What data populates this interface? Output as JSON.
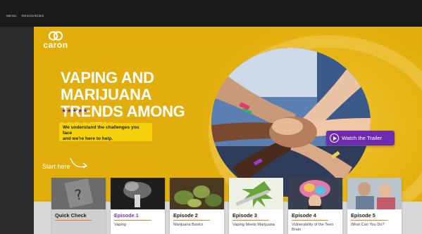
{
  "topbar": {
    "nav": [
      "MENU",
      "RESOURCES"
    ]
  },
  "logo": {
    "word": "caron"
  },
  "hero": {
    "headline_line1": "VAPING AND MARIJUANA",
    "headline_line2": "TRENDS AMONG YOUTH",
    "stars": "★★★★★",
    "callout_line1": "We understand the challenges you face",
    "callout_line2": "and we're here to help.",
    "start_label": "Start here",
    "trailer_label": "Watch the Trailer"
  },
  "cards": [
    {
      "title": "Quick Check",
      "subtitle": ""
    },
    {
      "title": "Episode 1",
      "subtitle": "Vaping"
    },
    {
      "title": "Episode 2",
      "subtitle": "Marijuana Basics"
    },
    {
      "title": "Episode 3",
      "subtitle": "Vaping Meets Marijuana"
    },
    {
      "title": "Episode 4",
      "subtitle": "Vulnerability of the Teen Brain"
    },
    {
      "title": "Episode 5",
      "subtitle": "What Can You Do?"
    }
  ],
  "colors": {
    "hero_yellow": "#e2ae0c",
    "accent_purple": "#6e2bb0",
    "callout_yellow": "#f5d20c",
    "topbar": "#1a1a1a"
  }
}
